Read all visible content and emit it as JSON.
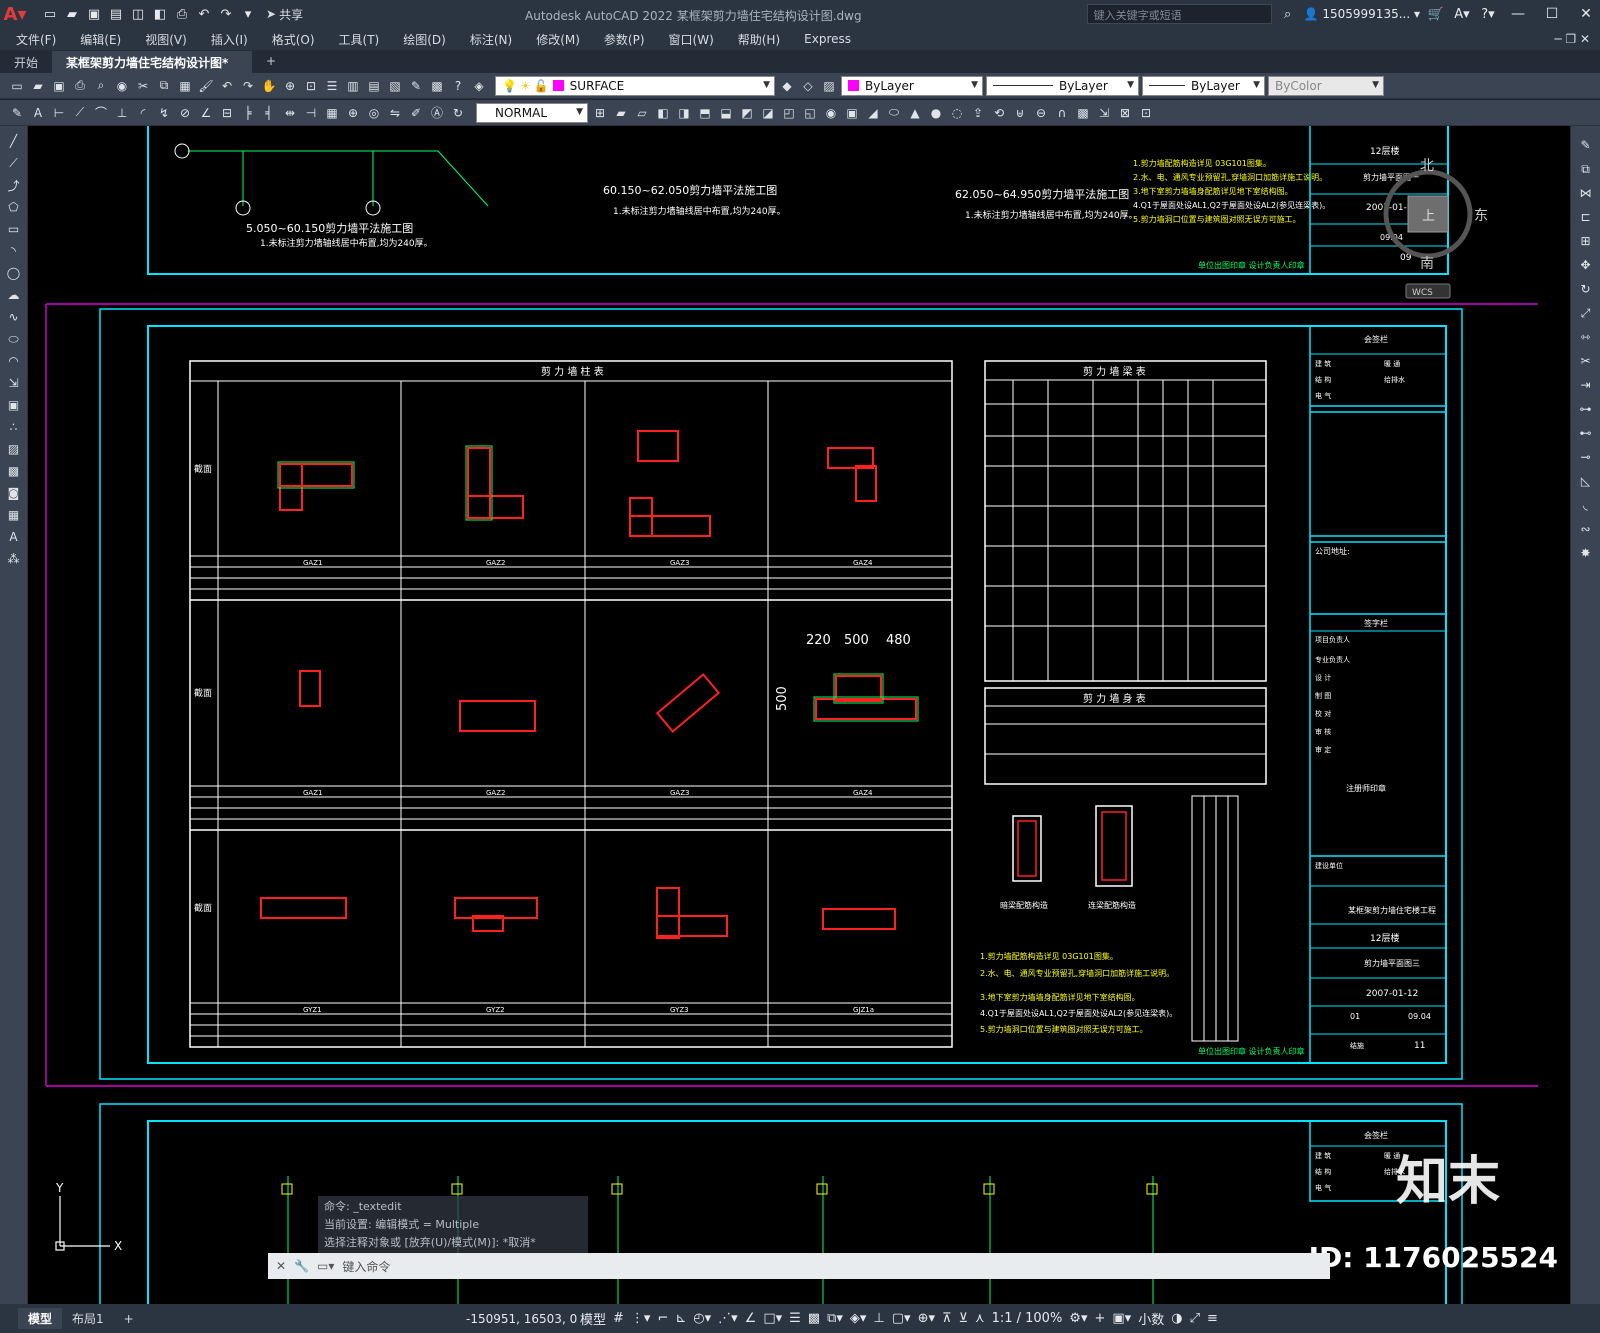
{
  "app": {
    "title": "Autodesk AutoCAD 2022    某框架剪力墙住宅结构设计图.dwg",
    "search_placeholder": "键入关键字或短语",
    "user": "1505999135...",
    "share": "共享"
  },
  "menu": [
    "文件(F)",
    "编辑(E)",
    "视图(V)",
    "插入(I)",
    "格式(O)",
    "工具(T)",
    "绘图(D)",
    "标注(N)",
    "修改(M)",
    "参数(P)",
    "窗口(W)",
    "帮助(H)",
    "Express"
  ],
  "doc_tabs": {
    "start": "开始",
    "active": "某框架剪力墙住宅结构设计图*",
    "plus": "+"
  },
  "toolbar": {
    "layer": "SURFACE",
    "color": "ByLayer",
    "linetype": "ByLayer",
    "lineweight": "ByLayer",
    "plotstyle": "ByColor",
    "textstyle": "NORMAL"
  },
  "viewcube": {
    "north": "北",
    "east": "东",
    "south": "南",
    "top": "上",
    "wcs": "WCS"
  },
  "drawing": {
    "plan1_title": "5.050~60.150剪力墙平法施工图",
    "plan1_note": "1.未标注剪力墙轴线居中布置,均为240厚。",
    "plan2_title": "60.150~62.050剪力墙平法施工图",
    "plan2_note": "1.未标注剪力墙轴线居中布置,均为240厚。",
    "plan3_title": "62.050~64.950剪力墙平法施工图",
    "plan3_note": "1.未标注剪力墙轴线居中布置,均为240厚。",
    "col_table_title": "剪 力 墙 柱 表",
    "beam_table_title": "剪 力 墙 梁 表",
    "body_table_title": "剪 力 墙 身 表",
    "section_label": "截面",
    "col_ids_row1": [
      "GAZ1",
      "GAZ2",
      "GAZ3",
      "GAZ4"
    ],
    "col_ids_row2": [
      "GAZ1",
      "GAZ2",
      "GAZ3",
      "GAZ4"
    ],
    "col_ids_row3": [
      "GYZ1",
      "GYZ2",
      "GYZ3",
      "GJZ1a"
    ],
    "dims_big": [
      "220",
      "500",
      "480",
      "500"
    ],
    "notes": [
      "1.剪力墙配筋构造详见 03G101图集。",
      "2.水、电、通风专业预留孔,穿墙洞口加筋详施工说明。",
      "3.地下室剪力墙墙身配筋详见地下室结构图。",
      "4.Q1于屋面处设AL1,Q2于屋面处设AL2(参见连梁表)。",
      "5.剪力墙洞口位置与建筑图对照无误方可施工。"
    ],
    "detail1": "暗梁配筋构造",
    "detail2": "连梁配筋构造",
    "sig_line": "单位出图印章  设计负责人印章",
    "tb": {
      "countersign": "会签栏",
      "arch": "建 筑",
      "hvac": "暖 通",
      "struct": "结 构",
      "plumb": "给排水",
      "elec": "电 气",
      "company": "公司地址:",
      "sign": "签字栏",
      "project_chief": "项目负责人",
      "sub_chief": "专业负责人",
      "designed": "设 计",
      "drawn": "制 图",
      "checked": "校 对",
      "examined": "审 核",
      "approved": "审 定",
      "seal": "注册师印章",
      "client": "建设单位",
      "project": "某框架剪力墙住宅楼工程",
      "subproject": "12层楼",
      "drawing_title": "剪力墙平面图三",
      "date": "2007-01-12",
      "edition": "01",
      "edition_date": "09.04",
      "drawing_type": "结施",
      "drawing_no": "11",
      "upper_date": "2007-01-12",
      "upper_title": "剪力墙平面图一",
      "upper_no": "09"
    }
  },
  "command": {
    "history": [
      "命令: _textedit",
      "当前设置: 编辑模式 = Multiple",
      "选择注释对象或 [放弃(U)/模式(M)]: *取消*"
    ],
    "placeholder": "键入命令"
  },
  "status": {
    "model_tab": "模型",
    "layout1": "布局1",
    "plus": "+",
    "coords": "-150951, 16503, 0",
    "space": "模型",
    "scale": "1:1 / 100%",
    "units": "小数"
  },
  "watermark": {
    "logo": "知末",
    "id": "ID: 1176025524"
  }
}
